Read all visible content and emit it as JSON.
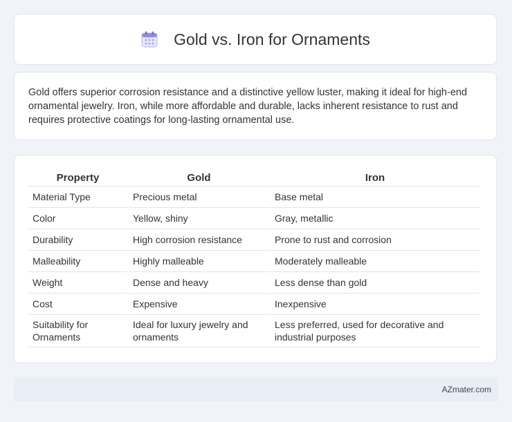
{
  "header": {
    "title": "Gold vs. Iron for Ornaments",
    "icon": "calendar-icon"
  },
  "intro": {
    "text": "Gold offers superior corrosion resistance and a distinctive yellow luster, making it ideal for high-end ornamental jewelry. Iron, while more affordable and durable, lacks inherent resistance to rust and requires protective coatings for long-lasting ornamental use."
  },
  "table": {
    "headers": [
      "Property",
      "Gold",
      "Iron"
    ],
    "rows": [
      [
        "Material Type",
        "Precious metal",
        "Base metal"
      ],
      [
        "Color",
        "Yellow, shiny",
        "Gray, metallic"
      ],
      [
        "Durability",
        "High corrosion resistance",
        "Prone to rust and corrosion"
      ],
      [
        "Malleability",
        "Highly malleable",
        "Moderately malleable"
      ],
      [
        "Weight",
        "Dense and heavy",
        "Less dense than gold"
      ],
      [
        "Cost",
        "Expensive",
        "Inexpensive"
      ],
      [
        "Suitability for Ornaments",
        "Ideal for luxury jewelry and ornaments",
        "Less preferred, used for decorative and industrial purposes"
      ]
    ]
  },
  "footer": {
    "credit": "AZmater.com"
  },
  "colors": {
    "background": "#f0f3f8",
    "card": "#ffffff",
    "border": "#dfe4ec",
    "footer": "#e8edf6",
    "icon_accent": "#8e8cf0"
  }
}
